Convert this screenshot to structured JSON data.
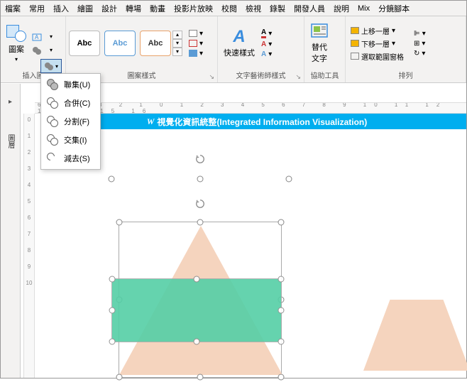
{
  "menubar": [
    "檔案",
    "常用",
    "插入",
    "繪圖",
    "設計",
    "轉場",
    "動畫",
    "投影片放映",
    "校閱",
    "檢視",
    "錄製",
    "開發人員",
    "說明",
    "Mix",
    "分鏡腳本"
  ],
  "ribbon": {
    "shapes_label": "圖案",
    "insert_group_label": "插入圖",
    "styles_group_label": "圖案樣式",
    "style_sample": "Abc",
    "wordart_group_label": "文字藝術師樣式",
    "quickstyle": "快速樣式",
    "access_group_label": "協助工具",
    "alttext": "替代\n文字",
    "arrange_group_label": "排列",
    "bring_forward": "上移一層",
    "send_backward": "下移一層",
    "selection_pane": "選取範圍窗格"
  },
  "merge_menu": {
    "union": "聯集(U)",
    "combine": "合併(C)",
    "fragment": "分割(F)",
    "intersect": "交集(I)",
    "subtract": "減去(S)"
  },
  "sidebar": {
    "label": "圖層"
  },
  "slide": {
    "title_prefix": "視覺化資訊統整",
    "title_suffix": "(Integrated Information Visualization)"
  },
  "ruler_h": "6 5 4 3 2 1 0 1 2 3 4 5 6 7 8 9 10 11 12 13 14 15 16",
  "ruler_v": [
    "0",
    "1",
    "2",
    "3",
    "4",
    "5",
    "6",
    "7",
    "8",
    "9",
    "10"
  ]
}
